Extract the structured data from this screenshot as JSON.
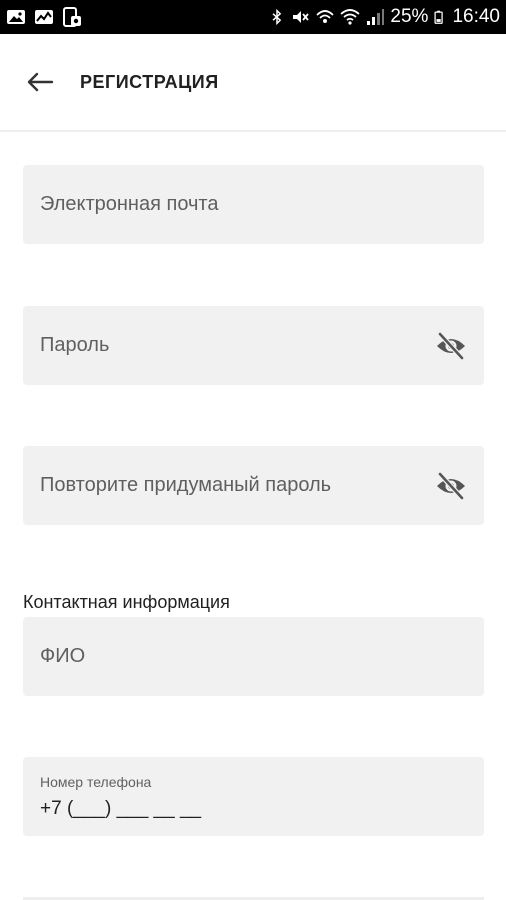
{
  "status_bar": {
    "battery": "25%",
    "time": "16:40"
  },
  "header": {
    "title": "РЕГИСТРАЦИЯ"
  },
  "form": {
    "email_placeholder": "Электронная почта",
    "password_placeholder": "Пароль",
    "confirm_password_placeholder": "Повторите придуманый пароль",
    "contact_section_label": "Контактная информация",
    "fullname_placeholder": "ФИО",
    "phone_label": "Номер телефона",
    "phone_value": "+7 (___) ___ __ __"
  },
  "icons": {
    "back": "arrow-left-icon",
    "password_toggle": "eye-off-icon"
  }
}
